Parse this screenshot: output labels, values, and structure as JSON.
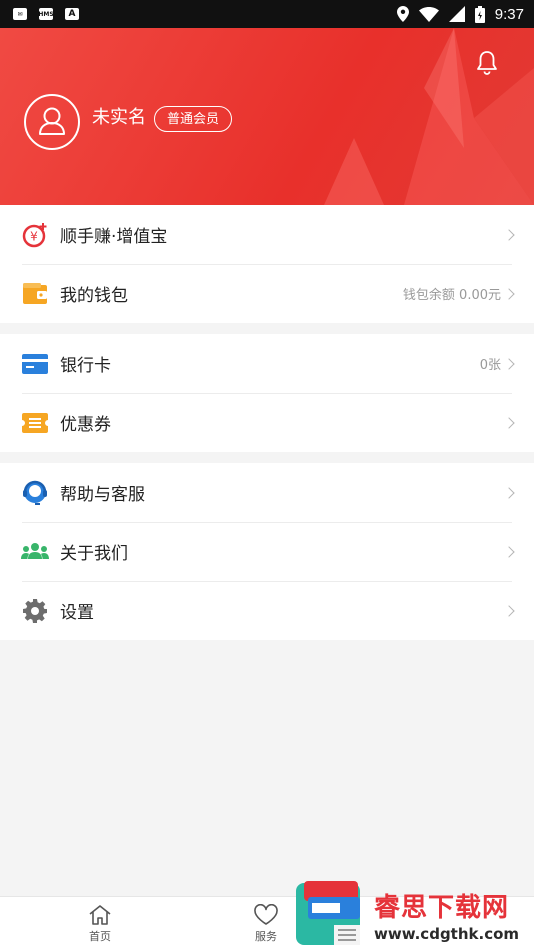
{
  "status_bar": {
    "time": "9:37",
    "icons": [
      "mail-icon",
      "hms-icon",
      "a-icon",
      "location-icon",
      "wifi-icon",
      "signal-icon",
      "battery-icon"
    ]
  },
  "profile": {
    "name": "未实名",
    "member_level": "普通会员"
  },
  "menu_groups": [
    [
      {
        "id": "zengzhibao",
        "label": "顺手赚·增值宝",
        "value": "",
        "icon": "yen-coin-icon"
      },
      {
        "id": "wallet",
        "label": "我的钱包",
        "value": "钱包余额 0.00元",
        "icon": "wallet-icon"
      }
    ],
    [
      {
        "id": "bank-card",
        "label": "银行卡",
        "value": "0张",
        "icon": "bank-card-icon"
      },
      {
        "id": "coupon",
        "label": "优惠券",
        "value": "",
        "icon": "coupon-icon"
      }
    ],
    [
      {
        "id": "help",
        "label": "帮助与客服",
        "value": "",
        "icon": "customer-service-icon"
      },
      {
        "id": "about",
        "label": "关于我们",
        "value": "",
        "icon": "about-us-icon"
      },
      {
        "id": "settings",
        "label": "设置",
        "value": "",
        "icon": "gear-icon"
      }
    ]
  ],
  "tabbar": {
    "home": "首页",
    "service": "服务"
  },
  "watermark": {
    "brand": "睿思下载网",
    "url": "www.cdgthk.com"
  },
  "colors": {
    "header_red": "#e8302b",
    "coin_red": "#e5333a",
    "wallet_orange": "#f6a623",
    "card_blue": "#2a80dc",
    "green": "#38b56a"
  }
}
